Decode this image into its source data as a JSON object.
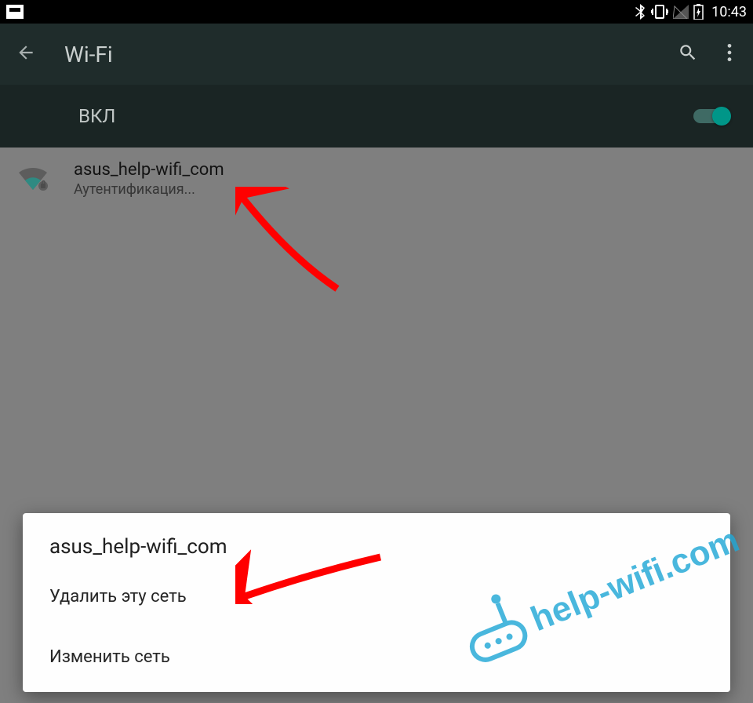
{
  "status": {
    "time": "10:43"
  },
  "appbar": {
    "title": "Wi-Fi"
  },
  "toggle": {
    "label": "ВКЛ",
    "on": true
  },
  "network": {
    "name": "asus_help-wifi_com",
    "status": "Аутентификация..."
  },
  "dialog": {
    "title": "asus_help-wifi_com",
    "delete": "Удалить эту сеть",
    "modify": "Изменить сеть"
  },
  "watermark": {
    "text": "help-wifi.com"
  }
}
